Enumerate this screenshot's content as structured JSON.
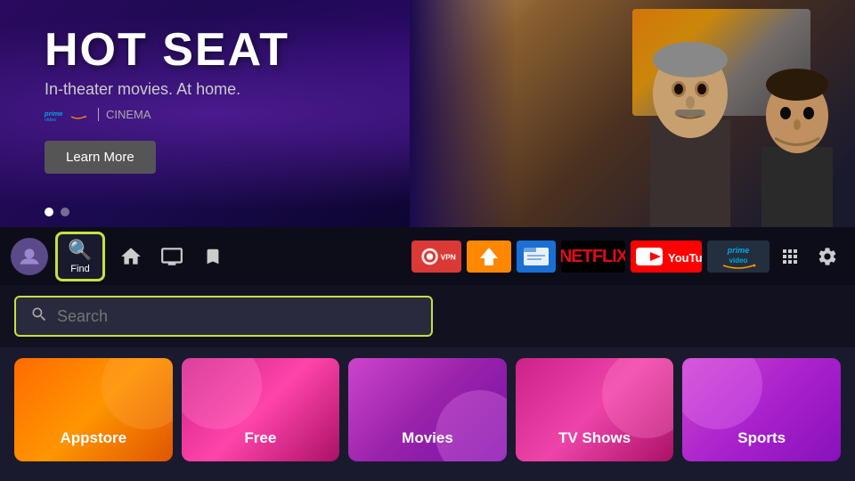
{
  "hero": {
    "title": "HOT SEAT",
    "subtitle": "In-theater movies. At home.",
    "brand": "prime video",
    "brand_separator": "|",
    "brand_type": "CINEMA",
    "learn_more": "Learn More",
    "dots": [
      true,
      false
    ]
  },
  "nav": {
    "find_label": "Find",
    "home_icon": "home",
    "tv_icon": "tv",
    "bookmark_icon": "bookmark"
  },
  "apps": [
    {
      "id": "expressvpn",
      "label": "ExpressVPN"
    },
    {
      "id": "downloader",
      "label": "Downloader"
    },
    {
      "id": "file-commander",
      "label": "File Commander"
    },
    {
      "id": "netflix",
      "label": "NETFLIX"
    },
    {
      "id": "youtube",
      "label": "YouTube"
    },
    {
      "id": "prime",
      "label": "prime video"
    }
  ],
  "search": {
    "placeholder": "Search"
  },
  "categories": [
    {
      "id": "appstore",
      "label": "Appstore"
    },
    {
      "id": "free",
      "label": "Free"
    },
    {
      "id": "movies",
      "label": "Movies"
    },
    {
      "id": "tvshows",
      "label": "TV Shows"
    },
    {
      "id": "sports",
      "label": "Sports"
    }
  ]
}
